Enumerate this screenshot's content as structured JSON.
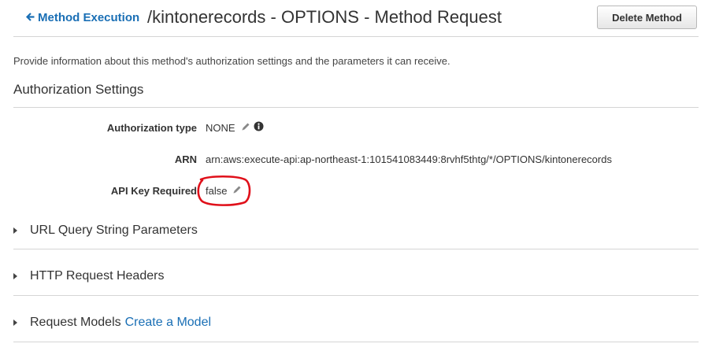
{
  "header": {
    "back_label": "Method Execution",
    "title": "/kintonerecords - OPTIONS - Method Request",
    "delete_label": "Delete Method"
  },
  "description": "Provide information about this method's authorization settings and the parameters it can receive.",
  "auth": {
    "heading": "Authorization Settings",
    "type_label": "Authorization type",
    "type_value": "NONE",
    "arn_label": "ARN",
    "arn_value": "arn:aws:execute-api:ap-northeast-1:101541083449:8rvhf5thtg/*/OPTIONS/kintonerecords",
    "api_key_label": "API Key Required",
    "api_key_value": "false"
  },
  "sections": {
    "query": "URL Query String Parameters",
    "headers": "HTTP Request Headers",
    "models": "Request Models",
    "create_model": "Create a Model"
  },
  "colors": {
    "link": "#1a6fb5",
    "annotation": "#e0101a"
  },
  "icons": [
    "arrow-left-icon",
    "pencil-icon",
    "info-icon",
    "caret-right-icon"
  ]
}
